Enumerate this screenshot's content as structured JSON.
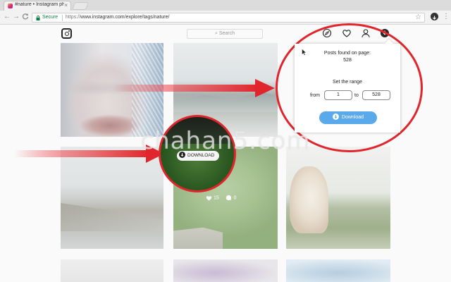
{
  "browser": {
    "tab_title": "#nature • Instagram pho",
    "tab_close": "×",
    "secure_label": "Secure",
    "url_scheme": "https://",
    "url_rest": "www.instagram.com/explore/tags/nature/",
    "back_glyph": "←",
    "forward_glyph": "→",
    "reload_glyph": "C",
    "star_glyph": "☆",
    "menu_glyph": "⋮",
    "icons": [
      "back-icon",
      "forward-icon",
      "reload-icon",
      "lock-icon",
      "star-icon",
      "extension-download-icon",
      "menu-icon"
    ]
  },
  "instagram": {
    "search_placeholder": "Search",
    "icons": [
      "instagram-logo-icon",
      "compass-icon",
      "heart-icon",
      "profile-icon",
      "download-extension-icon"
    ]
  },
  "grid": {
    "bird_likes": "15",
    "bird_comments": "0"
  },
  "overlay_button": {
    "label": "DOWNLOAD"
  },
  "popup": {
    "posts_label": "Posts found on page:",
    "posts_count": "528",
    "range_label": "Set the range",
    "from_label": "from",
    "from_value": "1",
    "to_label": "to",
    "to_value": "528",
    "download_label": "Download"
  },
  "watermark": "chahan5.com",
  "colors": {
    "annotation_red": "#e0262c",
    "download_button": "#5aa9ea",
    "secure_green": "#0b8043"
  }
}
